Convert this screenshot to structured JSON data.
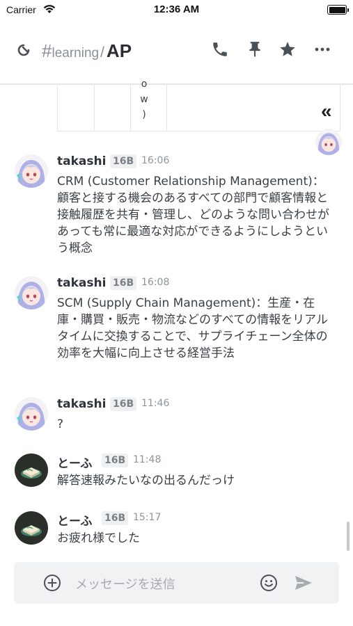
{
  "status_bar": {
    "carrier": "Carrier",
    "time": "12:36 AM"
  },
  "header": {
    "channel_hash": "#",
    "channel_name": "learning",
    "separator": "/",
    "title": "AP",
    "icons": [
      "back-refresh-icon",
      "phone-icon",
      "pin-icon",
      "star-icon",
      "more-icon"
    ]
  },
  "table_fragment": {
    "cell_text": [
      "o",
      "w",
      ")"
    ]
  },
  "messages": [
    {
      "author": "takashi",
      "badge": "16B",
      "time": "16:06",
      "text": "CRM (Customer Relationship Management)：顧客と接する機会のあるすべての部門で顧客情報と接触履歴を共有・管理し、どのような問い合わせがあっても常に最適な対応ができるようにしようという概念"
    },
    {
      "author": "takashi",
      "badge": "16B",
      "time": "16:08",
      "text": "SCM (Supply Chain Management)：生産・在庫・購買・販売・物流などのすべての情報をリアルタイムに交換することで、サプライチェーン全体の効率を大幅に向上させる経営手法"
    },
    {
      "author": "takashi",
      "badge": "16B",
      "time": "11:46",
      "text": "?"
    },
    {
      "author": "とーふ",
      "badge": "16B",
      "time": "11:48",
      "text": "解答速報みたいなの出るんだっけ"
    },
    {
      "author": "とーふ",
      "badge": "16B",
      "time": "15:17",
      "text": "お疲れ様でした"
    }
  ],
  "composer": {
    "placeholder": "メッセージを送信",
    "icons": [
      "add-icon",
      "emoji-icon",
      "send-icon"
    ]
  },
  "colors": {
    "text_primary": "#2f343d",
    "text_secondary": "#8e949a",
    "badge_bg": "#eef0f2",
    "composer_bg": "#f1f2f4",
    "divider": "#e4e6e8"
  }
}
